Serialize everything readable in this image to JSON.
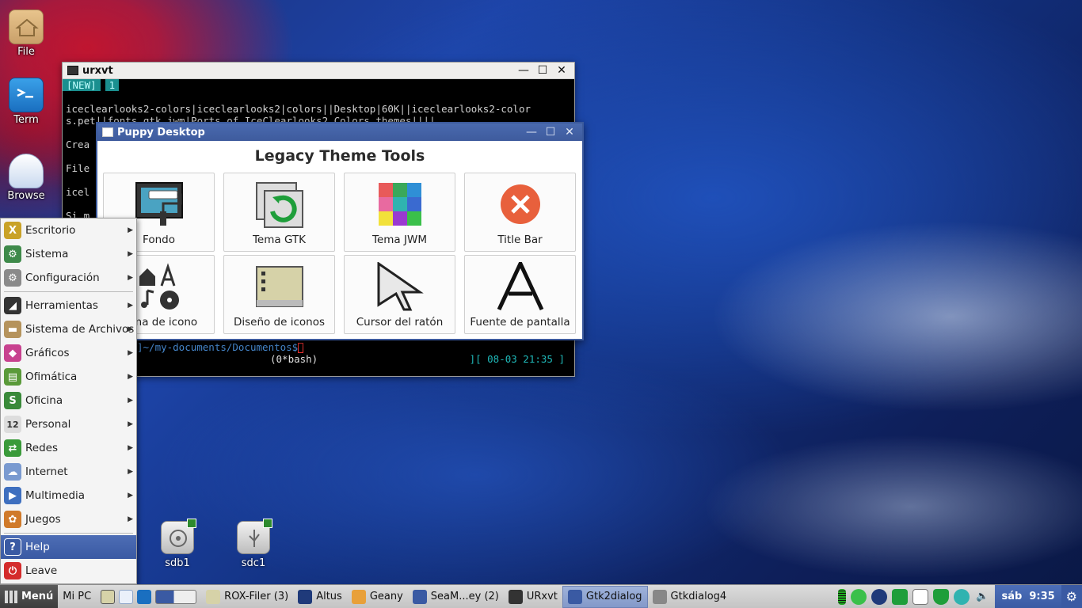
{
  "desktop_icons": [
    {
      "label": "File",
      "icon": "home-folder-icon"
    },
    {
      "label": "Term",
      "icon": "terminal-icon"
    },
    {
      "label": "Browse",
      "icon": "cloud-icon"
    }
  ],
  "drives": [
    {
      "label": "sdb1",
      "icon": "hard-drive-icon"
    },
    {
      "label": "sdc1",
      "icon": "usb-drive-icon"
    }
  ],
  "urxvt": {
    "title": "urxvt",
    "tabs": [
      "[NEW]",
      "1"
    ],
    "lines": [
      "",
      "iceclearlooks2-colors|iceclearlooks2|colors||Desktop|60K||iceclearlooks2-color",
      "s.pet||fonts,gtk,jwm|Ports of IceClearlooks2 Colors themes||||",
      "",
      "Crea",
      "",
      "File",
      "",
      "icel",
      "",
      "Si m"
    ],
    "prompt": "]~/my-documents/Documentos$",
    "session": "(0*bash)",
    "datetime": "][ 08-03 21:35 ]"
  },
  "dialog": {
    "title": "Puppy Desktop",
    "heading": "Legacy Theme Tools",
    "tools": [
      {
        "label": "Fondo",
        "icon": "wallpaper-paint-roller-icon"
      },
      {
        "label": "Tema GTK",
        "icon": "gtk-refresh-icon"
      },
      {
        "label": "Tema JWM",
        "icon": "color-grid-icon"
      },
      {
        "label": "Title Bar",
        "icon": "close-circle-icon"
      },
      {
        "label": "Tema de icono",
        "icon": "icon-theme-icon"
      },
      {
        "label": "Diseño de iconos",
        "icon": "icon-layout-icon"
      },
      {
        "label": "Cursor del ratón",
        "icon": "mouse-cursor-icon"
      },
      {
        "label": "Fuente de pantalla",
        "icon": "font-icon"
      }
    ]
  },
  "menu": {
    "items": [
      {
        "label": "Escritorio",
        "color": "#c9a227",
        "glyph": "X",
        "sub": true
      },
      {
        "label": "Sistema",
        "color": "#3e8a4a",
        "glyph": "⚙",
        "sub": true
      },
      {
        "label": "Configuración",
        "color": "#8a8a8a",
        "glyph": "⚙",
        "sub": true
      },
      {
        "label": "Herramientas",
        "color": "#333333",
        "glyph": "◢",
        "sub": true
      },
      {
        "label": "Sistema de Archivos",
        "color": "#b5935c",
        "glyph": "▬",
        "sub": true
      },
      {
        "label": "Gráficos",
        "color": "#c8428f",
        "glyph": "◆",
        "sub": true
      },
      {
        "label": "Ofimática",
        "color": "#5a9a3a",
        "glyph": "▤",
        "sub": true
      },
      {
        "label": "Oficina",
        "color": "#3a8a3a",
        "glyph": "S",
        "sub": true
      },
      {
        "label": "Personal",
        "color": "#dddddd",
        "glyph": "12",
        "sub": true
      },
      {
        "label": "Redes",
        "color": "#3a9a3a",
        "glyph": "⇄",
        "sub": true
      },
      {
        "label": "Internet",
        "color": "#7a9ad0",
        "glyph": "☁",
        "sub": true
      },
      {
        "label": "Multimedia",
        "color": "#3e6fbf",
        "glyph": "▶",
        "sub": true
      },
      {
        "label": "Juegos",
        "color": "#d07a2a",
        "glyph": "✿",
        "sub": true
      }
    ],
    "help": "Help",
    "leave": "Leave"
  },
  "taskbar": {
    "menu_label": "Menú",
    "mypc": "Mi PC",
    "tasks": [
      {
        "label": "ROX-Filer (3)",
        "icon": "rox-filer-icon"
      },
      {
        "label": "Altus",
        "icon": "altus-icon"
      },
      {
        "label": "Geany",
        "icon": "geany-icon"
      },
      {
        "label": "SeaM...ey (2)",
        "icon": "seamonkey-icon"
      },
      {
        "label": "URxvt",
        "icon": "terminal-icon"
      },
      {
        "label": "Gtk2dialog",
        "icon": "gtkdialog-icon"
      },
      {
        "label": "Gtkdialog4",
        "icon": "gtkdialog-icon"
      }
    ],
    "clock": "sáb  9:35"
  },
  "colors": {
    "dialog_title": "#3e5b9d",
    "menu_active": "#3a5aa3",
    "terminal_tab": "#1a8f8f"
  }
}
